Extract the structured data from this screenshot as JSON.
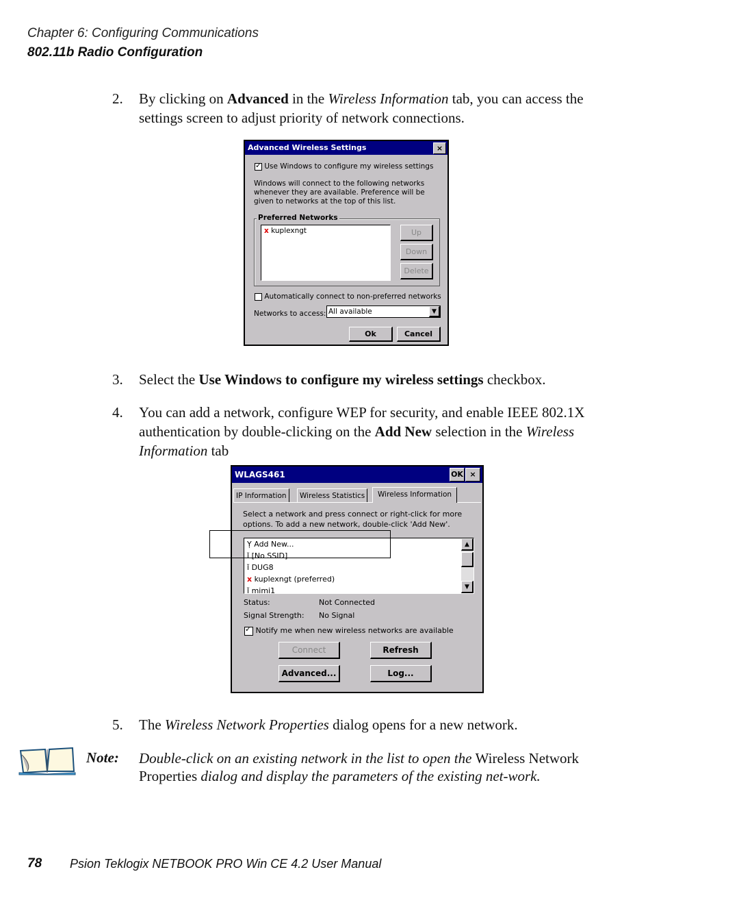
{
  "header": {
    "chapter": "Chapter 6:  Configuring Communications",
    "section": "802.11b Radio Configuration"
  },
  "steps": [
    {
      "num": "2.",
      "parts": [
        "By clicking on ",
        "Advanced",
        " in the ",
        "Wireless Information",
        " tab, you can access the settings screen to adjust priority of network connections."
      ]
    },
    {
      "num": "3.",
      "parts": [
        "Select the ",
        "Use Windows to configure my wireless settings",
        " checkbox."
      ]
    },
    {
      "num": "4.",
      "parts": [
        "You can add a network, configure WEP for security, and enable IEEE 802.1X authentication by double-clicking on the ",
        "Add New",
        " selection in the ",
        "Wireless Information",
        " tab"
      ]
    },
    {
      "num": "5.",
      "parts": [
        "The ",
        "Wireless Network Properties",
        " dialog opens for a new network."
      ]
    }
  ],
  "advanced_dialog": {
    "title": "Advanced Wireless Settings",
    "close": "×",
    "use_windows_label": "Use Windows to configure my wireless settings",
    "use_windows_checked": true,
    "description": "Windows will connect to the following networks whenever they are available.  Preference will be given to networks at the top of this list.",
    "group_label": "Preferred Networks",
    "networks": [
      "kuplexngt"
    ],
    "buttons": {
      "up": "Up",
      "down": "Down",
      "delete": "Delete",
      "ok": "Ok",
      "cancel": "Cancel"
    },
    "auto_connect_label": "Automatically connect to non-preferred networks",
    "auto_connect_checked": false,
    "access_label": "Networks to access:",
    "access_value": "All available"
  },
  "wlags_dialog": {
    "title": "WLAGS461",
    "ok": "OK",
    "close": "×",
    "tabs": [
      "IP Information",
      "Wireless Statistics",
      "Wireless Information"
    ],
    "active_tab": "Wireless Information",
    "instructions": "Select a network and press connect or right-click for more options.  To add a new network, double-click 'Add New'.",
    "networks": [
      {
        "label": "Add New...",
        "icon": "antenna-icon"
      },
      {
        "label": "[No SSID]",
        "icon": "network-icon"
      },
      {
        "label": "DUG8",
        "icon": "network-icon"
      },
      {
        "label": "kuplexngt (preferred)",
        "icon": "network-preferred-icon"
      },
      {
        "label": "mimi1",
        "icon": "network-icon"
      }
    ],
    "status_label": "Status:",
    "status_value": "Not Connected",
    "signal_label": "Signal Strength:",
    "signal_value": "No Signal",
    "notify_label": "Notify me when new wireless networks are available",
    "notify_checked": true,
    "buttons": {
      "connect": "Connect",
      "refresh": "Refresh",
      "advanced": "Advanced...",
      "log": "Log..."
    }
  },
  "note": {
    "label": "Note:",
    "parts": [
      "Double-click on an existing network in the list to open the ",
      "Wireless Network Properties",
      " dialog and display the parameters of the existing net-work."
    ]
  },
  "footer": {
    "page": "78",
    "title": "Psion Teklogix NETBOOK PRO Win CE 4.2 User Manual"
  }
}
